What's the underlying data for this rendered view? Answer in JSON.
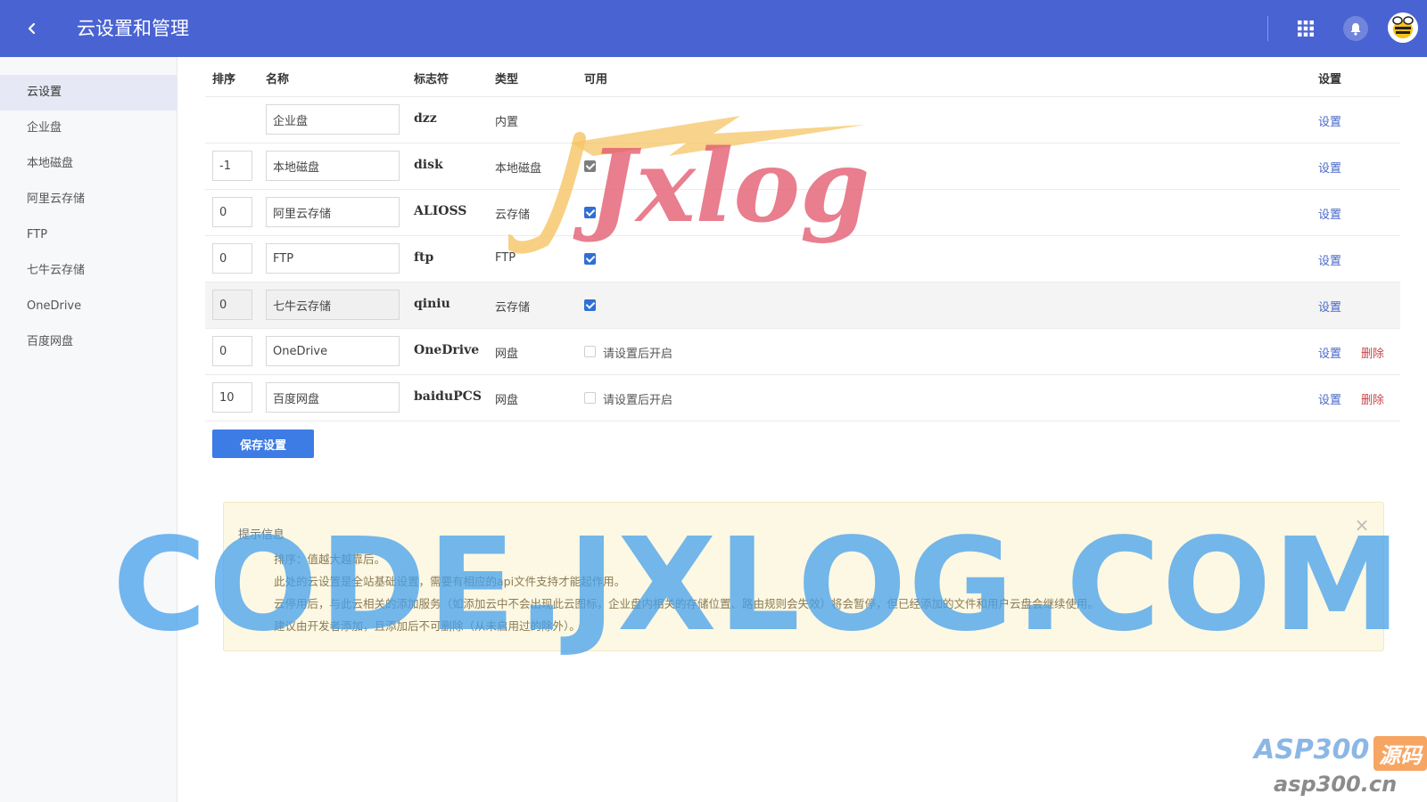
{
  "header": {
    "title": "云设置和管理",
    "icons": {
      "back": "chevron-left-icon",
      "apps": "grid-icon",
      "notifications": "bell-icon",
      "avatar": "user-avatar"
    },
    "colors": {
      "bar": "#4a63d3"
    }
  },
  "sidebar": {
    "items": [
      {
        "label": "云设置",
        "active": true
      },
      {
        "label": "企业盘",
        "active": false
      },
      {
        "label": "本地磁盘",
        "active": false
      },
      {
        "label": "阿里云存储",
        "active": false
      },
      {
        "label": "FTP",
        "active": false
      },
      {
        "label": "七牛云存储",
        "active": false
      },
      {
        "label": "OneDrive",
        "active": false
      },
      {
        "label": "百度网盘",
        "active": false
      }
    ]
  },
  "table": {
    "headers": {
      "sort": "排序",
      "name": "名称",
      "identifier": "标志符",
      "type": "类型",
      "enabled": "可用",
      "settings": "设置"
    },
    "rows": [
      {
        "sort": "",
        "name": "企业盘",
        "identifier": "dzz",
        "type": "内置",
        "enabled": null,
        "enabled_label": "",
        "set_label": "设置",
        "delete_label": ""
      },
      {
        "sort": "-1",
        "name": "本地磁盘",
        "identifier": "disk",
        "type": "本地磁盘",
        "enabled": true,
        "enabled_label": "",
        "set_label": "设置",
        "delete_label": ""
      },
      {
        "sort": "0",
        "name": "阿里云存储",
        "identifier": "ALIOSS",
        "type": "云存储",
        "enabled": true,
        "enabled_label": "",
        "set_label": "设置",
        "delete_label": ""
      },
      {
        "sort": "0",
        "name": "FTP",
        "identifier": "ftp",
        "type": "FTP",
        "enabled": true,
        "enabled_label": "",
        "set_label": "设置",
        "delete_label": ""
      },
      {
        "sort": "0",
        "name": "七牛云存储",
        "identifier": "qiniu",
        "type": "云存储",
        "enabled": true,
        "enabled_label": "",
        "set_label": "设置",
        "delete_label": ""
      },
      {
        "sort": "0",
        "name": "OneDrive",
        "identifier": "OneDrive",
        "type": "网盘",
        "enabled": false,
        "enabled_label": "请设置后开启",
        "set_label": "设置",
        "delete_label": "删除"
      },
      {
        "sort": "10",
        "name": "百度网盘",
        "identifier": "baiduPCS",
        "type": "网盘",
        "enabled": false,
        "enabled_label": "请设置后开启",
        "set_label": "设置",
        "delete_label": "删除"
      }
    ]
  },
  "save_button": "保存设置",
  "tip": {
    "title": "提示信息",
    "close_icon": "close-icon",
    "lines": [
      "排序：值越大越靠后。",
      "此处的云设置是全站基础设置，需要有相应的api文件支持才能起作用。",
      "云停用后，与此云相关的添加服务（如添加云中不会出现此云图标，企业盘内相关的存储位置、路由规则会失效）将会暂停，但已经添加的文件和用户云盘会继续使用。",
      "建议由开发者添加，且添加后不可删除（从未启用过的除外）。"
    ]
  },
  "watermarks": {
    "center_text": "CODE.JXLOG.COM",
    "logo_text": "Jxlog",
    "corner_a": "ASP300",
    "corner_b": "源码",
    "corner_c": "asp300.cn"
  }
}
